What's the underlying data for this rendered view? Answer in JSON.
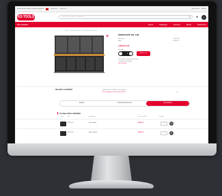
{
  "topbar": {
    "left_text": "Professional tooling & garage equipment",
    "link_1": "Blog tools",
    "link_2": "Contact us",
    "account": "My account",
    "language": "English"
  },
  "header": {
    "logo_text": "KS TOOLS",
    "search_placeholder": "Search for a product, a reference...",
    "cart_count": "0"
  },
  "nav": {
    "items": [
      "Our products",
      "Brand",
      "Catalogue",
      "Services",
      "Media",
      "Distributors"
    ]
  },
  "breadcrumb": "Home > Workshop furniture > Workshop furniture 2M",
  "product": {
    "title": "WORKSHOP 2M, 11M",
    "ref_label": "Reference:",
    "ref_value": "865.0001",
    "ean_label": "EAN:",
    "ean_value": "4042146...",
    "price": "4 990,00 € HT",
    "qty_label": "Quantity",
    "qty_value": "1",
    "add_button": "Add to cart",
    "note_1": "• Professional workshop furniture",
    "note_2": "• Delivered assembled",
    "note_link": "See all details"
  },
  "delivery": {
    "title": "DELIVERY & PAYMENT",
    "line_1": "Delivery within 4 weeks - free shipping",
    "line_2": "Secure payment and customer service"
  },
  "tabs": [
    {
      "label": "Details",
      "active": false
    },
    {
      "label": "Technical documents",
      "active": false
    },
    {
      "label": "Composition",
      "active": true
    }
  ],
  "composition": {
    "title": "Composition détaillée",
    "headers": {
      "image": "Visual",
      "ref": "Ref.",
      "desc": "Designation",
      "price": "Price excl. VAT",
      "qty": "Quantity"
    },
    "rows": [
      {
        "ref": "865.0101",
        "desc": "Tool cabinet",
        "price": "690,00 €",
        "qty": "1"
      },
      {
        "ref": "865.0102",
        "desc": "Base cabinet",
        "price": "690,00 €",
        "qty": "1"
      }
    ]
  },
  "colors": {
    "accent": "#e4032d",
    "frame": "#111111",
    "background": "#2d3135"
  }
}
